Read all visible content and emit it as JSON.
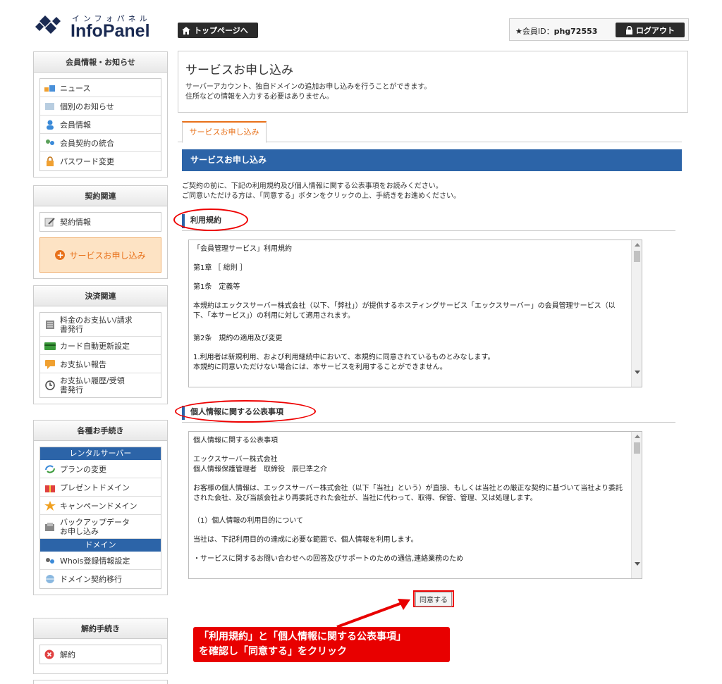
{
  "header": {
    "logo_kana": "インフォパネル",
    "logo_name": "InfoPanel",
    "top_button": "トップページへ",
    "member_id_label": "★会員ID：",
    "member_id": "phg72553",
    "logout_button": "ログアウト"
  },
  "sidebar": {
    "member": {
      "title": "会員情報・お知らせ",
      "items": [
        "ニュース",
        "個別のお知らせ",
        "会員情報",
        "会員契約の統合",
        "パスワード変更"
      ]
    },
    "contract": {
      "title": "契約関連",
      "items": [
        "契約情報"
      ],
      "highlight": "サービスお申し込み"
    },
    "payment": {
      "title": "決済関連",
      "items": [
        "料金のお支払い/請求書発行",
        "カード自動更新設定",
        "お支払い報告",
        "お支払い履歴/受領書発行"
      ]
    },
    "procedures": {
      "title": "各種お手続き",
      "rental_header": "レンタルサーバー",
      "rental_items": [
        "プランの変更",
        "プレゼントドメイン",
        "キャンペーンドメイン",
        "バックアップデータお申し込み"
      ],
      "domain_header": "ドメイン",
      "domain_items": [
        "Whois登録情報設定",
        "ドメイン契約移行"
      ]
    },
    "cancel": {
      "title": "解約手続き",
      "items": [
        "解約"
      ]
    }
  },
  "main": {
    "title": "サービスお申し込み",
    "desc1": "サーバーアカウント、独自ドメインの追加お申し込みを行うことができます。",
    "desc2": "住所などの情報を入力する必要はありません。",
    "tab": "サービスお申し込み",
    "section_header": "サービスお申し込み",
    "intro1": "ご契約の前に、下記の利用規約及び個人情報に関する公表事項をお読みください。",
    "intro2": "ご同意いただける方は、「同意する」ボタンをクリックの上、手続きをお進めください。",
    "terms": {
      "heading": "利用規約",
      "lines": [
        "「会員管理サービス」利用規約",
        "第1章 ［ 総則 ］",
        "第1条　定義等",
        "本規約はエックスサーバー株式会社（以下、「弊社」）が提供するホスティングサービス「エックスサーバー」の会員管理サービス（以下、「本サービス」）の利用に対して適用されます。",
        "第2条　規約の適用及び変更",
        "1.利用者は新規利用、および利用継続中において、本規約に同意されているものとみなします。",
        "本規約に同意いただけない場合には、本サービスを利用することができません。"
      ]
    },
    "privacy": {
      "heading": "個人情報に関する公表事項",
      "lines": [
        "個人情報に関する公表事項",
        "エックスサーバー株式会社",
        "個人情報保護管理者　取締役　辰巳準之介",
        "お客様の個人情報は、エックスサーバー株式会社（以下「当社」という）が直接、もしくは当社との厳正な契約に基づいて当社より委託された会社、及び当該会社より再委託された会社が、当社に代わって、取得、保管、管理、又は処理します。",
        "（1）個人情報の利用目的について",
        "当社は、下記利用目的の達成に必要な範囲で、個人情報を利用します。",
        "・サービスに関するお問い合わせへの回答及びサポートのための通信,連絡業務のため"
      ]
    },
    "agree_button": "同意する"
  },
  "annotation": {
    "line1": "「利用規約」と「個人情報に関する公表事項」",
    "line2": "を確認し「同意する」をクリック"
  },
  "colors": {
    "accent_blue": "#2c64a8",
    "accent_orange": "#e8711a",
    "annotation_red": "#e80000"
  }
}
